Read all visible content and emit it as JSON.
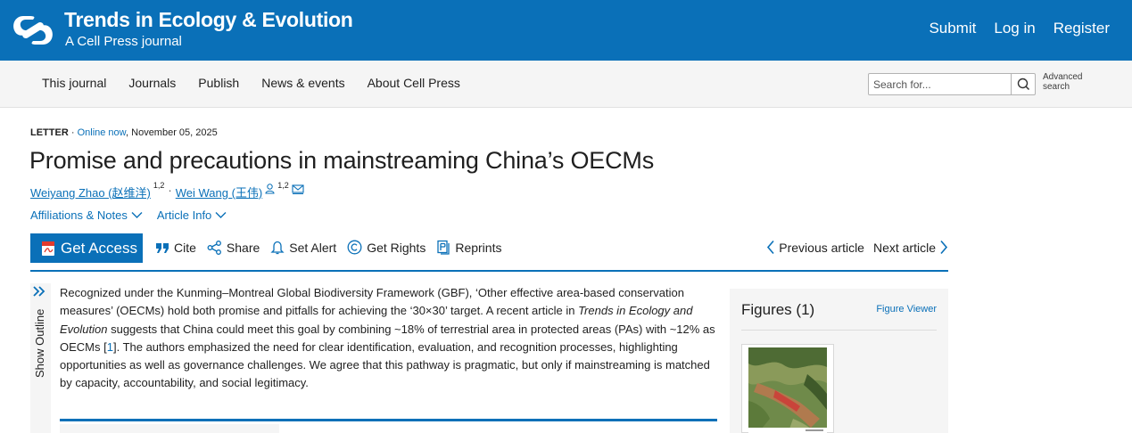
{
  "header": {
    "journal_title": "Trends in Ecology & Evolution",
    "journal_subtitle": "A Cell Press journal",
    "links": [
      "Submit",
      "Log in",
      "Register"
    ],
    "brand_color": "#0a70b8"
  },
  "nav": {
    "items": [
      "This journal",
      "Journals",
      "Publish",
      "News & events",
      "About Cell Press"
    ],
    "search_placeholder": "Search for...",
    "advanced_search": "Advanced search"
  },
  "article": {
    "type": "LETTER",
    "online_label": "Online now",
    "date": ", November 05, 2025",
    "title": "Promise and precautions in mainstreaming China’s OECMs",
    "authors": [
      {
        "name": "Weiyang Zhao (赵维洋)",
        "sup": "1,2"
      },
      {
        "name": "Wei Wang (王伟)",
        "sup": "1,2"
      }
    ],
    "affiliations_label": "Affiliations & Notes",
    "article_info_label": "Article Info"
  },
  "actions": {
    "get_access": "Get Access",
    "cite": "Cite",
    "share": "Share",
    "set_alert": "Set Alert",
    "get_rights": "Get Rights",
    "reprints": "Reprints",
    "previous": "Previous article",
    "next": "Next article"
  },
  "outline": {
    "label": "Show Outline"
  },
  "abstract": {
    "part1": "Recognized under the Kunming–Montreal Global Biodiversity Framework (GBF), ‘Other effective area-based conservation measures’ (OECMs) hold both promise and pitfalls for achieving the ‘30×30’ target. A recent article in ",
    "journal_italic": "Trends in Ecology and Evolution",
    "part2": " suggests that China could meet this goal by combining ~18% of terrestrial area in protected areas (PAs) with ~12% as OECMs [",
    "ref": "1",
    "part3": "]. The authors emphasized the need for clear identification, evaluation, and recognition processes, highlighting opportunities as well as governance challenges. We agree that this pathway is pragmatic, but only if mainstreaming is matched by capacity, accountability, and social legitimacy."
  },
  "figures": {
    "title": "Figures (1)",
    "viewer_label": "Figure Viewer"
  }
}
